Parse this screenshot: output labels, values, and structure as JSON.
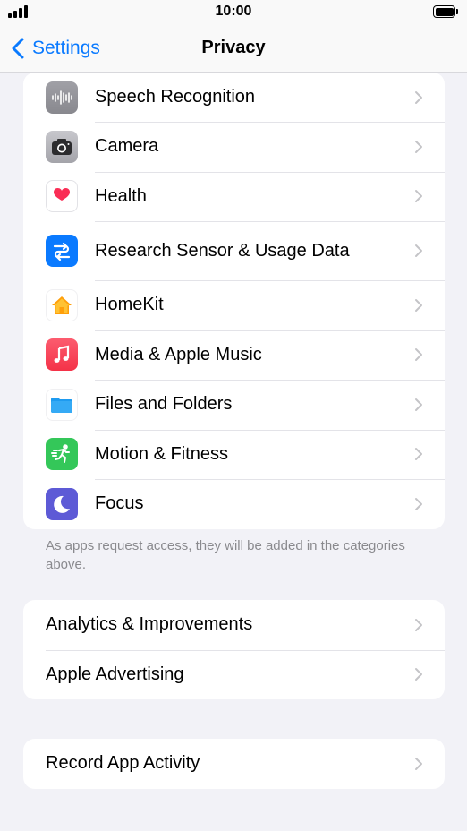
{
  "status_bar": {
    "time": "10:00"
  },
  "nav": {
    "back_label": "Settings",
    "title": "Privacy"
  },
  "group1": {
    "rows": [
      {
        "label": "Speech Recognition",
        "icon": "waveform-icon"
      },
      {
        "label": "Camera",
        "icon": "camera-icon"
      },
      {
        "label": "Health",
        "icon": "heart-icon"
      },
      {
        "label": "Research Sensor & Usage Data",
        "icon": "research-icon"
      },
      {
        "label": "HomeKit",
        "icon": "home-icon"
      },
      {
        "label": "Media & Apple Music",
        "icon": "music-note-icon"
      },
      {
        "label": "Files and Folders",
        "icon": "folder-icon"
      },
      {
        "label": "Motion & Fitness",
        "icon": "running-figure-icon"
      },
      {
        "label": "Focus",
        "icon": "moon-icon"
      }
    ],
    "footer": "As apps request access, they will be added in the categories above."
  },
  "group2": {
    "rows": [
      {
        "label": "Analytics & Improvements"
      },
      {
        "label": "Apple Advertising"
      }
    ]
  },
  "group3": {
    "rows": [
      {
        "label": "Record App Activity"
      }
    ]
  },
  "colors": {
    "accent": "#0a7aff",
    "background": "#f2f2f7",
    "secondary_text": "#8a8a8e"
  }
}
